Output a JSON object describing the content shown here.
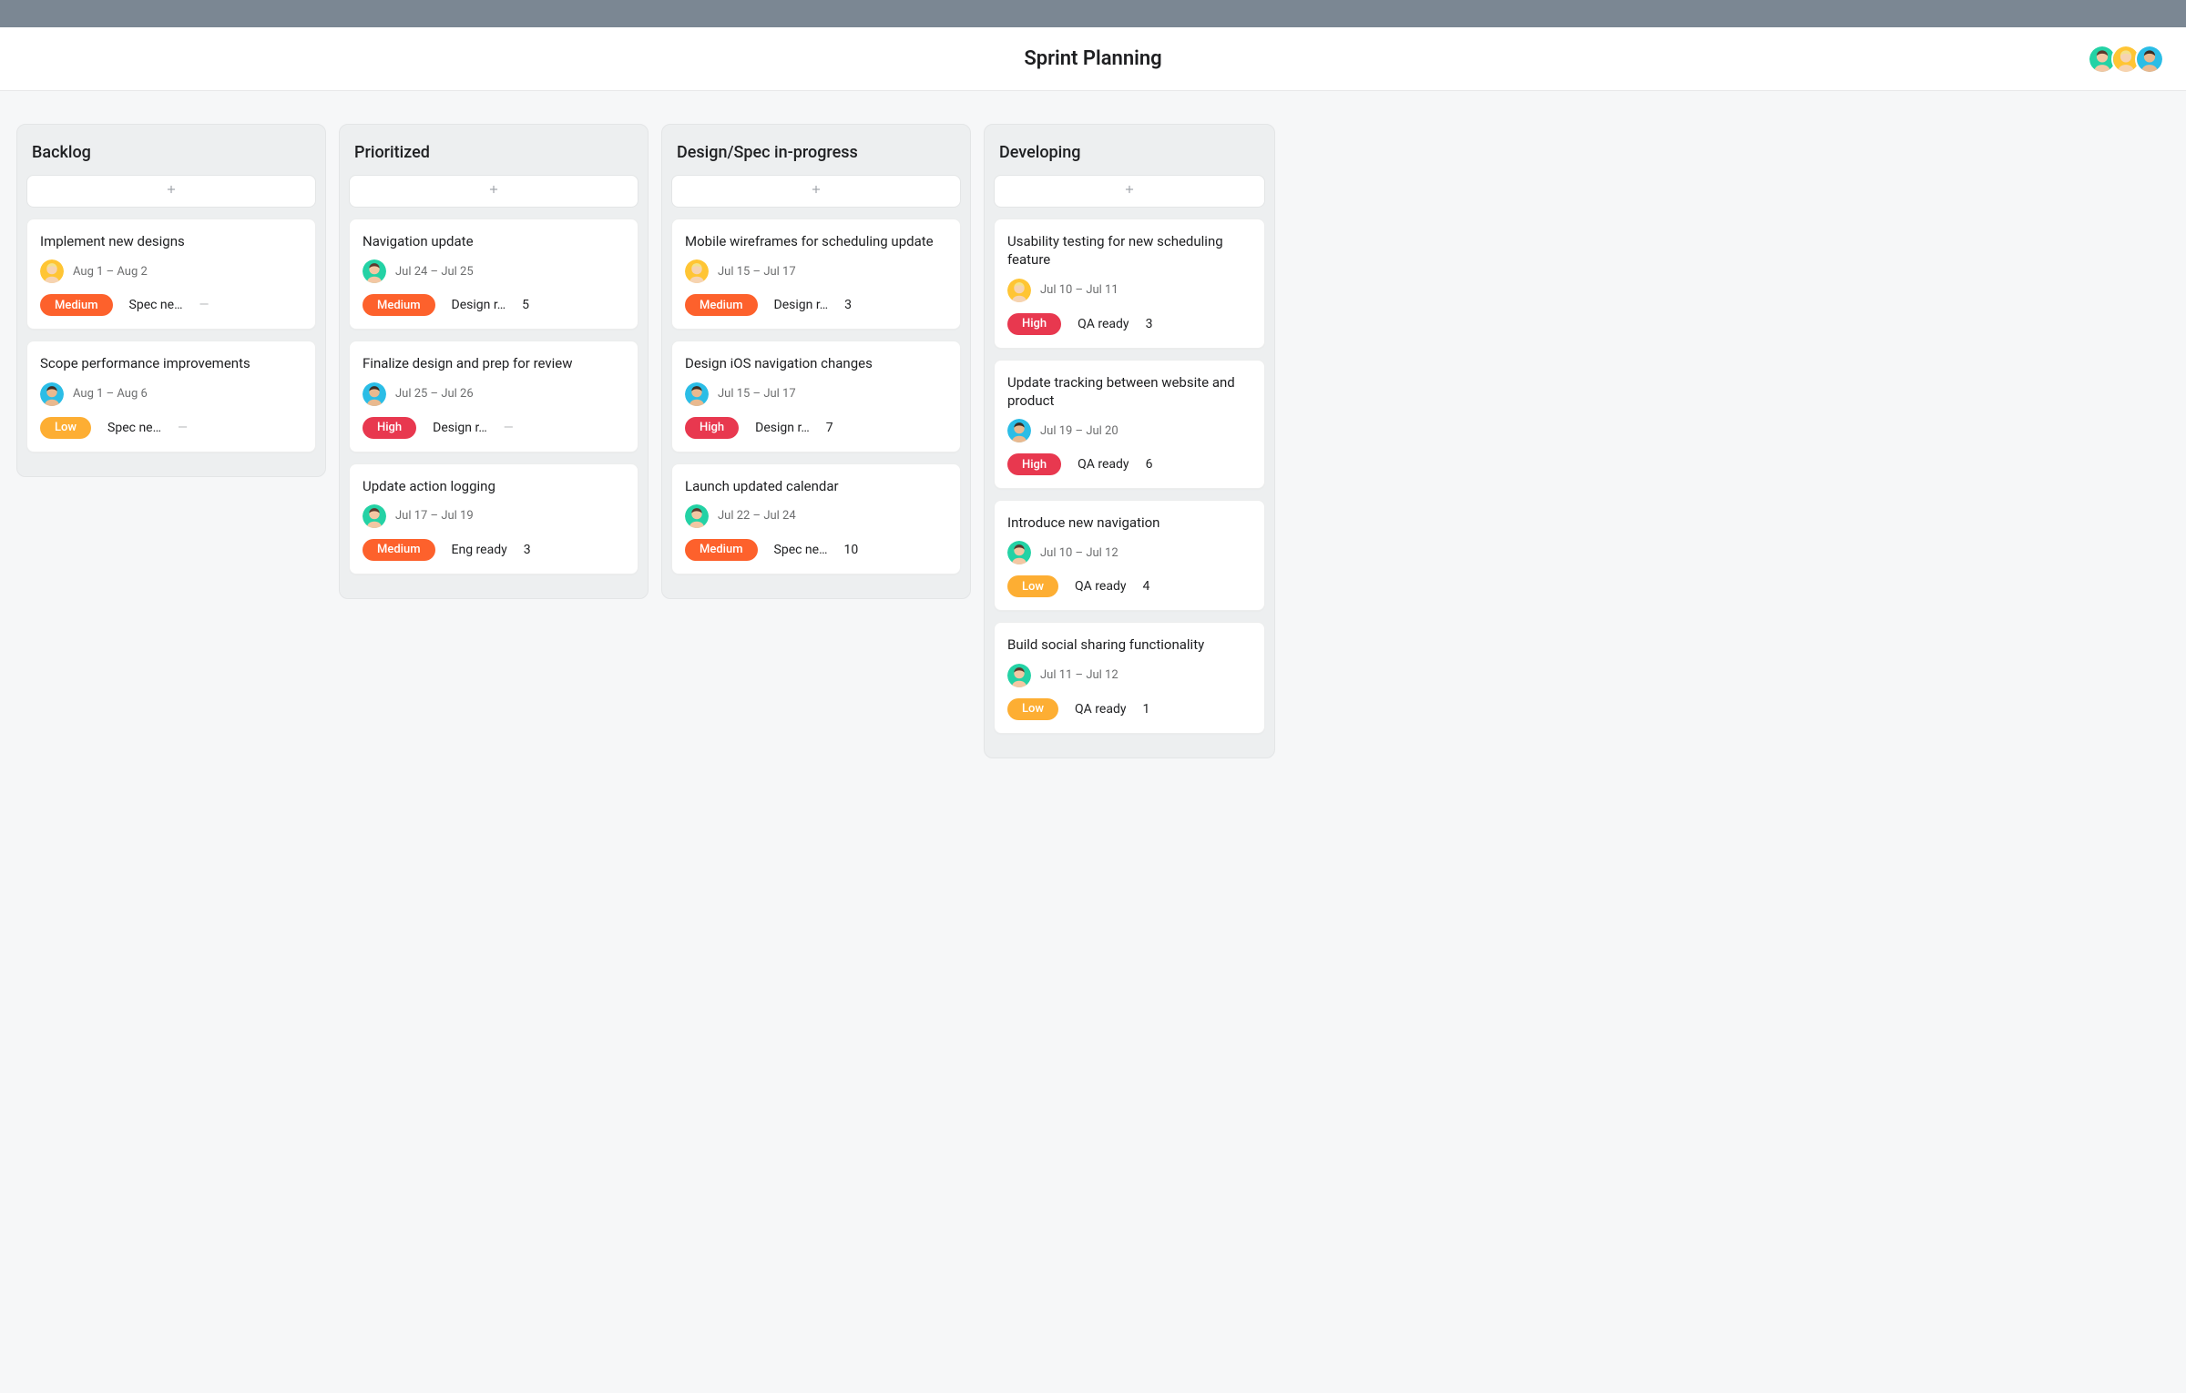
{
  "header": {
    "title": "Sprint Planning",
    "avatars": [
      "teal",
      "yellow",
      "cyan"
    ]
  },
  "avatarColors": {
    "teal": {
      "bg": "#24d2a5",
      "skin": "#f3c7a3",
      "hair": "#5b3a2e"
    },
    "yellow": {
      "bg": "#ffc534",
      "skin": "#f6d3b1",
      "hair": "#f3e28c"
    },
    "cyan": {
      "bg": "#2bbde6",
      "skin": "#e9b98f",
      "hair": "#3c2d24"
    }
  },
  "priorityClass": {
    "Medium": "medium",
    "High": "high",
    "Low": "low"
  },
  "columns": [
    {
      "title": "Backlog",
      "cards": [
        {
          "title": "Implement new designs",
          "avatar": "yellow",
          "date": "Aug 1 – Aug 2",
          "priority": "Medium",
          "tag": "Spec ne…",
          "count": "—",
          "countMuted": true
        },
        {
          "title": "Scope performance improvements",
          "avatar": "cyan",
          "date": "Aug 1 – Aug 6",
          "priority": "Low",
          "tag": "Spec ne…",
          "count": "—",
          "countMuted": true
        }
      ]
    },
    {
      "title": "Prioritized",
      "cards": [
        {
          "title": "Navigation update",
          "avatar": "teal",
          "date": "Jul 24 – Jul 25",
          "priority": "Medium",
          "tag": "Design r…",
          "count": "5"
        },
        {
          "title": "Finalize design and prep for review",
          "avatar": "cyan",
          "date": "Jul 25 – Jul 26",
          "priority": "High",
          "tag": "Design r…",
          "count": "—",
          "countMuted": true
        },
        {
          "title": "Update action logging",
          "avatar": "teal",
          "date": "Jul 17 – Jul 19",
          "priority": "Medium",
          "tag": "Eng ready",
          "count": "3"
        }
      ]
    },
    {
      "title": "Design/Spec in-progress",
      "cards": [
        {
          "title": "Mobile wireframes for scheduling update",
          "avatar": "yellow",
          "date": "Jul 15 – Jul 17",
          "priority": "Medium",
          "tag": "Design r…",
          "count": "3"
        },
        {
          "title": "Design iOS navigation changes",
          "avatar": "cyan",
          "date": "Jul 15 – Jul 17",
          "priority": "High",
          "tag": "Design r…",
          "count": "7"
        },
        {
          "title": "Launch updated calendar",
          "avatar": "teal",
          "date": "Jul 22 – Jul 24",
          "priority": "Medium",
          "tag": "Spec ne…",
          "count": "10"
        }
      ]
    },
    {
      "title": "Developing",
      "cards": [
        {
          "title": "Usability testing for new scheduling feature",
          "avatar": "yellow",
          "date": "Jul 10 – Jul 11",
          "priority": "High",
          "tag": "QA ready",
          "count": "3"
        },
        {
          "title": "Update tracking between website and product",
          "avatar": "cyan",
          "date": "Jul 19 – Jul 20",
          "priority": "High",
          "tag": "QA ready",
          "count": "6"
        },
        {
          "title": "Introduce new navigation",
          "avatar": "teal",
          "date": "Jul 10 – Jul 12",
          "priority": "Low",
          "tag": "QA ready",
          "count": "4"
        },
        {
          "title": "Build social sharing functionality",
          "avatar": "teal",
          "date": "Jul 11 – Jul 12",
          "priority": "Low",
          "tag": "QA ready",
          "count": "1"
        }
      ]
    }
  ]
}
